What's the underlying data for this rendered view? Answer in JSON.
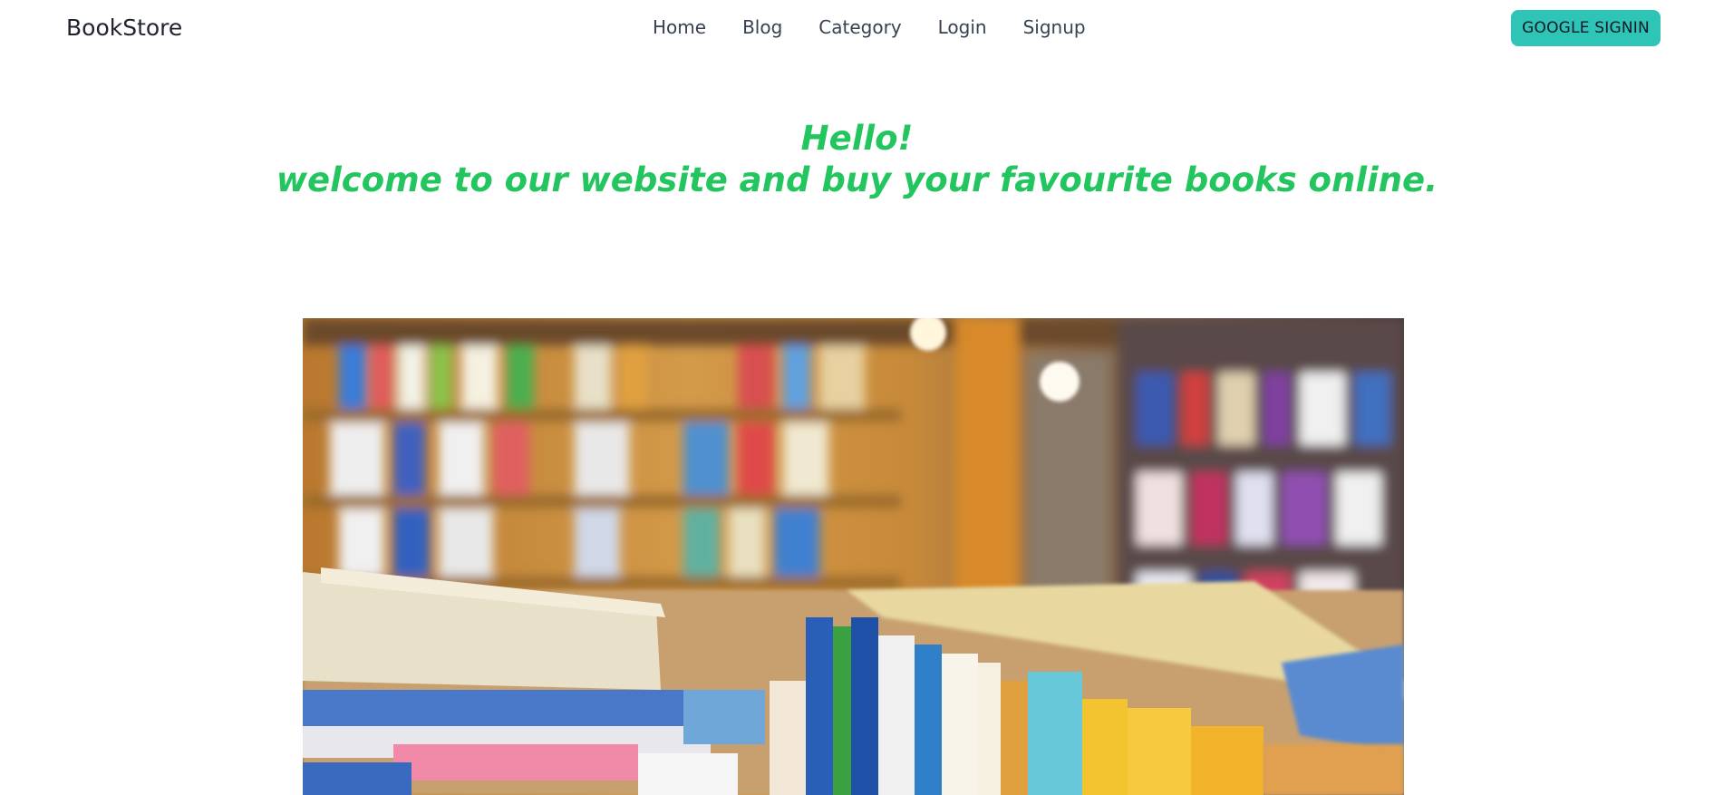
{
  "navbar": {
    "brand": "BookStore",
    "links": [
      {
        "label": "Home"
      },
      {
        "label": "Blog"
      },
      {
        "label": "Category"
      },
      {
        "label": "Login"
      },
      {
        "label": "Signup"
      }
    ],
    "google_signin_label": "GOOGLE SIGNIN"
  },
  "hero": {
    "line1": "Hello!",
    "line2": "welcome to our website and buy your favourite books online."
  },
  "colors": {
    "accent_green": "#22c55e",
    "button_teal": "#2ec4b6"
  },
  "image": {
    "subject": "bookstore-shelves-photo"
  }
}
